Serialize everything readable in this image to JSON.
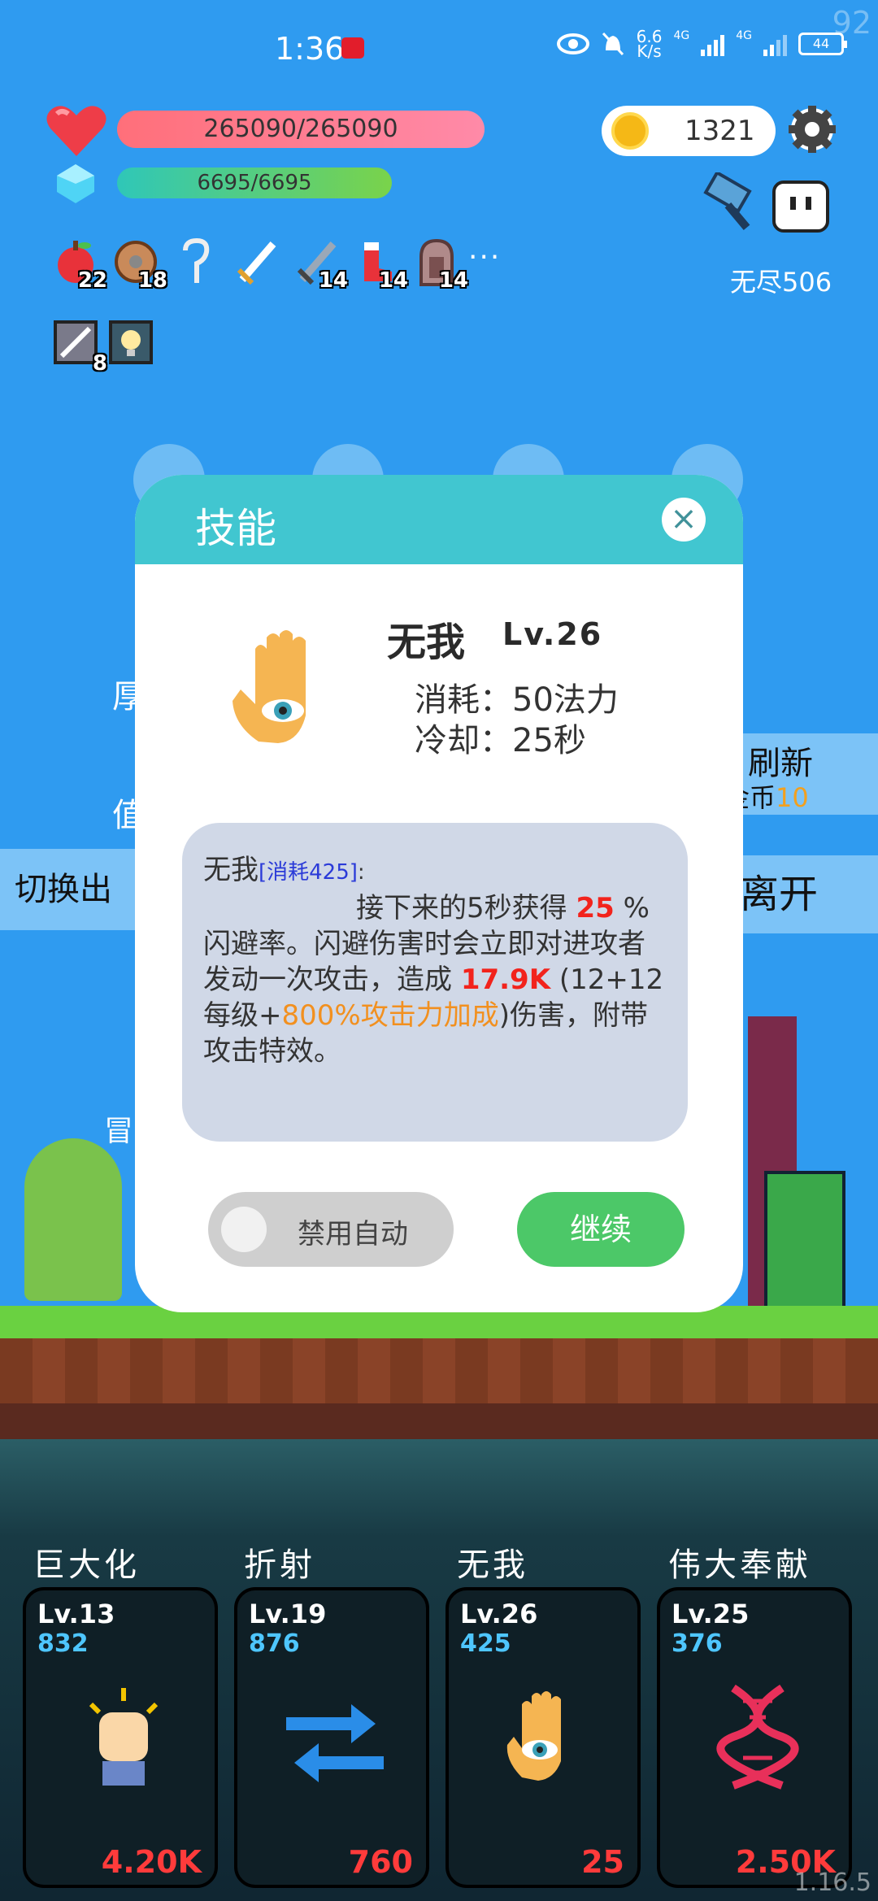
{
  "status_bar": {
    "time": "1:36",
    "app_badge": "ANNT",
    "speed": "6.6",
    "speed_unit": "K/s",
    "net1": "4G",
    "net2": "4G",
    "battery": "44",
    "fps": "92"
  },
  "hud": {
    "hp": "265090/265090",
    "mp": "6695/6695",
    "coins": "1321",
    "mode": "无尽506",
    "items": [
      {
        "icon": "apple-icon",
        "count": "22"
      },
      {
        "icon": "shield-icon",
        "count": "18"
      },
      {
        "icon": "hook-icon",
        "count": ""
      },
      {
        "icon": "sword-icon",
        "count": ""
      },
      {
        "icon": "sword2-icon",
        "count": "14"
      },
      {
        "icon": "boot-icon",
        "count": "14"
      },
      {
        "icon": "tombstone-icon",
        "count": "14"
      }
    ],
    "more": "···",
    "items2": [
      {
        "icon": "rune-icon",
        "count": "8"
      },
      {
        "icon": "lamp-icon",
        "count": ""
      }
    ]
  },
  "background": {
    "refresh_label": "刷新",
    "refresh_cost_label": "金币",
    "refresh_cost": "10",
    "leave_label": "离开",
    "switch_label": "切换出",
    "left_text_1": "厚",
    "left_text_2": "值",
    "left_text_3": "冒"
  },
  "dialog": {
    "title": "技能",
    "close": "×",
    "skill_name": "无我",
    "skill_level": "Lv.26",
    "cost_line": "消耗：50法力",
    "cooldown_line": "冷却：25秒",
    "desc_name": "无我",
    "desc_cost_tag": "[消耗425]",
    "desc_colon": ":",
    "desc_line1": "接下来的5秒获得",
    "desc_dodge_value": "25",
    "desc_line2": "%闪避率。闪避伤害时会立即对进攻者发动一次攻击，造成",
    "desc_damage": "17.9K",
    "desc_formula_pre": "(12+12每级+",
    "desc_formula_bonus": "800%攻击力加成",
    "desc_formula_post": ")伤害，附带攻击特效。",
    "toggle_label": "禁用自动",
    "continue_label": "继续"
  },
  "skills": [
    {
      "name": "巨大化",
      "level": "Lv.13",
      "cost": "832",
      "value": "4.20K",
      "icon": "fist-icon"
    },
    {
      "name": "折射",
      "level": "Lv.19",
      "cost": "876",
      "value": "760",
      "icon": "arrows-icon"
    },
    {
      "name": "无我",
      "level": "Lv.26",
      "cost": "425",
      "value": "25",
      "icon": "eye-hand-icon"
    },
    {
      "name": "伟大奉献",
      "level": "Lv.25",
      "cost": "376",
      "value": "2.50K",
      "icon": "dna-icon"
    }
  ],
  "version": "1.16.5",
  "colors": {
    "sky": "#2f9bf0",
    "dialog_header": "#41c6d0",
    "continue": "#4cc868",
    "damage": "#f2231c",
    "bonus": "#f2901f"
  }
}
